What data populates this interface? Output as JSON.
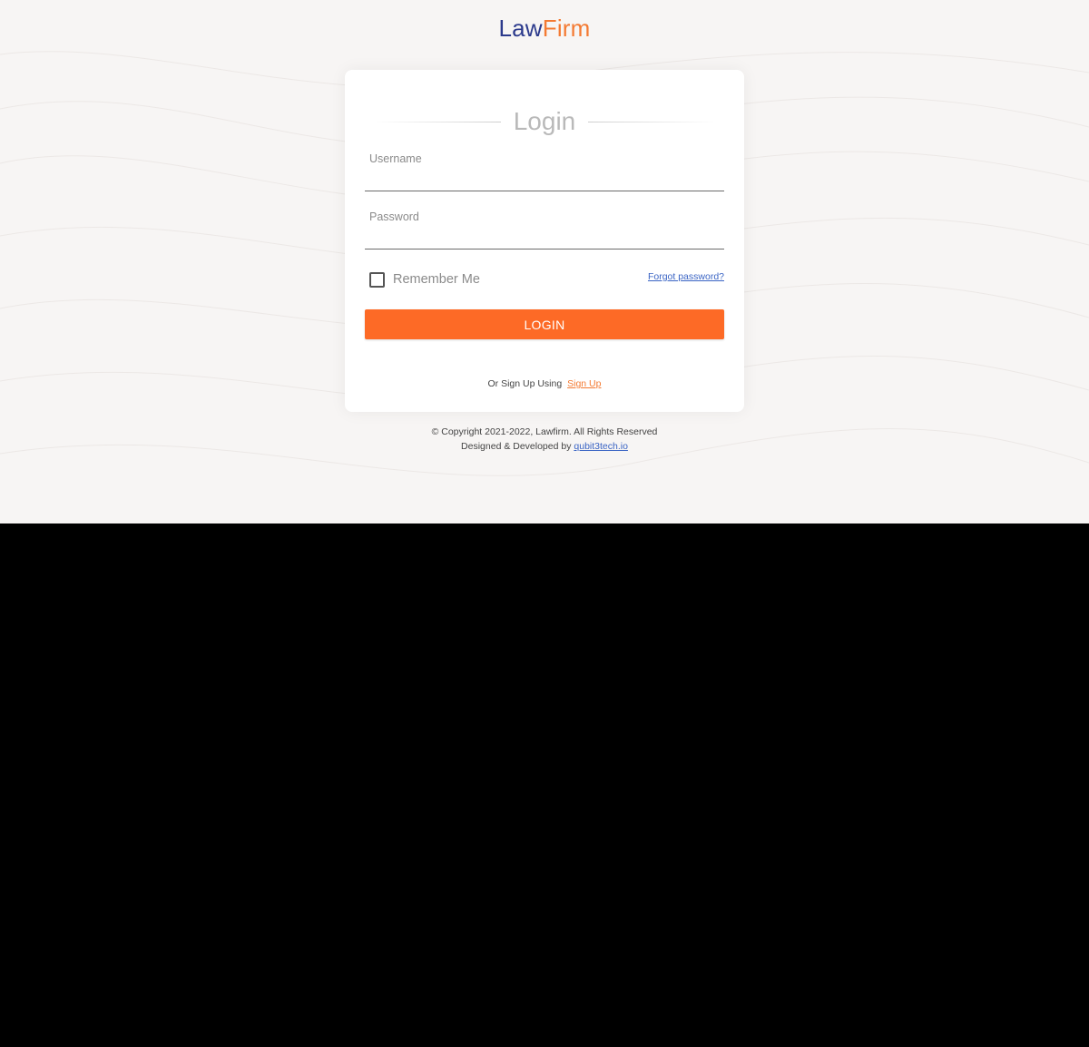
{
  "brand": {
    "part1": "Law",
    "part2": "Firm",
    "color_part1": "#2c3a8c",
    "color_part2": "#f47a32"
  },
  "login_card": {
    "title": "Login",
    "username_label": "Username",
    "username_value": "",
    "password_label": "Password",
    "password_value": "",
    "remember_label": "Remember Me",
    "remember_checked": false,
    "forgot_label": "Forgot password?",
    "submit_label": "LOGIN",
    "signup_prompt": "Or Sign Up Using",
    "signup_link": "Sign Up"
  },
  "footer": {
    "copyright": "© Copyright 2021-2022, Lawfirm. All Rights Reserved",
    "designed_prefix": "Designed & Developed by",
    "developer_link": "qubit3tech.io"
  },
  "colors": {
    "accent": "#fd6a26",
    "link": "#3a64c4",
    "background": "#f7f5f4"
  }
}
